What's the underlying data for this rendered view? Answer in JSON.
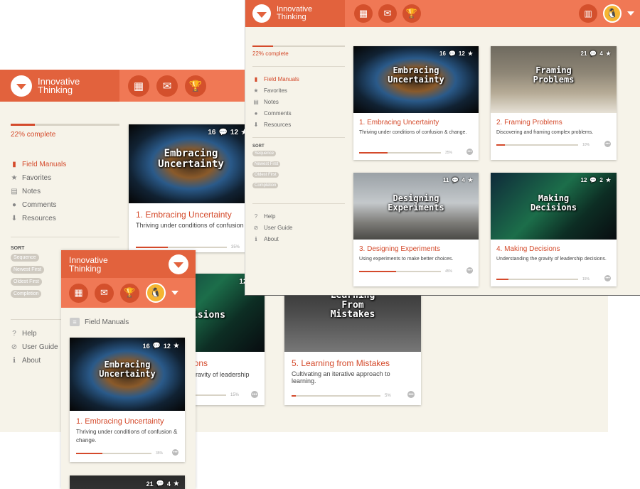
{
  "app": {
    "title": "Innovative Thinking",
    "accent": "#e2623d",
    "header_light": "#f07855",
    "background": "#f6f3e9"
  },
  "nav_icons": [
    "grid-icon",
    "comment-icon",
    "trophy-icon"
  ],
  "progress": {
    "label": "22% complete",
    "value": 0.22
  },
  "menu": [
    {
      "label": "Field Manuals",
      "icon": "book-icon",
      "active": true
    },
    {
      "label": "Favorites",
      "icon": "star-icon"
    },
    {
      "label": "Notes",
      "icon": "notes-icon"
    },
    {
      "label": "Comments",
      "icon": "comment-icon"
    },
    {
      "label": "Resources",
      "icon": "download-icon"
    }
  ],
  "sort": {
    "heading": "SORT",
    "options": [
      "Sequence",
      "Newest First",
      "Oldest First",
      "Completion"
    ]
  },
  "footer_menu": [
    {
      "label": "Help",
      "icon": "help-icon"
    },
    {
      "label": "User Guide",
      "icon": "guide-icon"
    },
    {
      "label": "About",
      "icon": "info-icon"
    }
  ],
  "mobile": {
    "section_title": "Field Manuals"
  },
  "cards": [
    {
      "title": "1. Embracing Uncertainty",
      "desc": "Thriving under conditions of confusion & change.",
      "image_text": "Embracing Uncertainty",
      "comments": "16",
      "stars": "12",
      "progress_pct": "35%",
      "progress": 0.35
    },
    {
      "title": "2. Framing Problems",
      "desc": "Discovering and framing complex problems.",
      "image_text": "Framing Problems",
      "comments": "21",
      "stars": "4",
      "progress_pct": "10%",
      "progress": 0.1
    },
    {
      "title": "3. Designing Experiments",
      "desc": "Using experiments to make better choices.",
      "image_text": "Designing Experiments",
      "comments": "11",
      "stars": "4",
      "progress_pct": "45%",
      "progress": 0.45
    },
    {
      "title": "4. Making Decisions",
      "desc": "Understanding the gravity of leadership decisions.",
      "image_text": "Making Decisions",
      "comments": "12",
      "stars": "2",
      "progress_pct": "15%",
      "progress": 0.15
    },
    {
      "title": "5. Learning from Mistakes",
      "desc": "Cultivating an iterative approach to learning.",
      "image_text": "Learning From Mistakes",
      "comments": "",
      "stars": "",
      "progress_pct": "5%",
      "progress": 0.05
    }
  ],
  "back_partial": {
    "card4_title_fragment": "ions",
    "card4_desc_fragment": "gravity of leadership",
    "card4_image_fragment": "isions",
    "card4_comments": "12"
  }
}
